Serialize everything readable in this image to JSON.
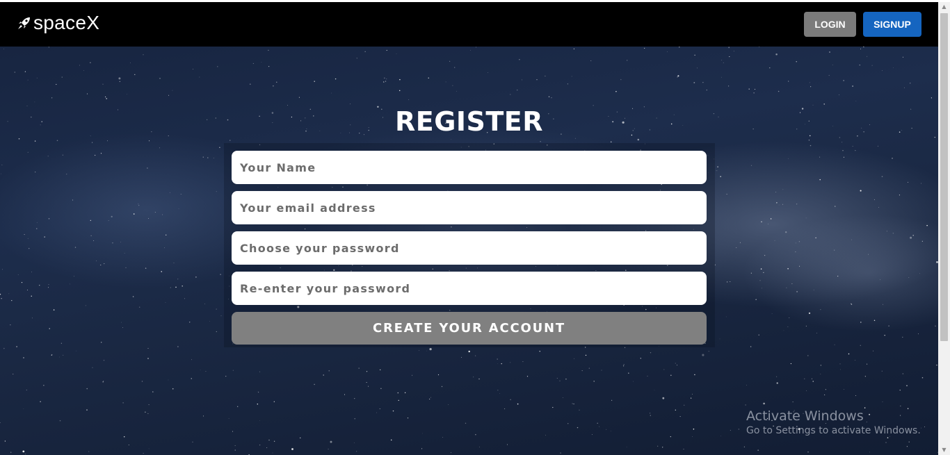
{
  "navbar": {
    "brand": "spaceX",
    "brand_icon": "rocket-icon",
    "login_label": "LOGIN",
    "signup_label": "SIGNUP"
  },
  "form": {
    "title": "REGISTER",
    "name_placeholder": "Your Name",
    "email_placeholder": "Your email address",
    "password_placeholder": "Choose your password",
    "confirm_placeholder": "Re-enter your password",
    "submit_label": "CREATE YOUR ACCOUNT"
  },
  "watermark": {
    "title": "Activate Windows",
    "subtitle": "Go to Settings to activate Windows."
  },
  "colors": {
    "navbar_bg": "#000000",
    "login_bg": "#7b7b7b",
    "signup_bg": "#1565c0",
    "submit_bg": "#808080",
    "background": "#1d2d4c"
  }
}
